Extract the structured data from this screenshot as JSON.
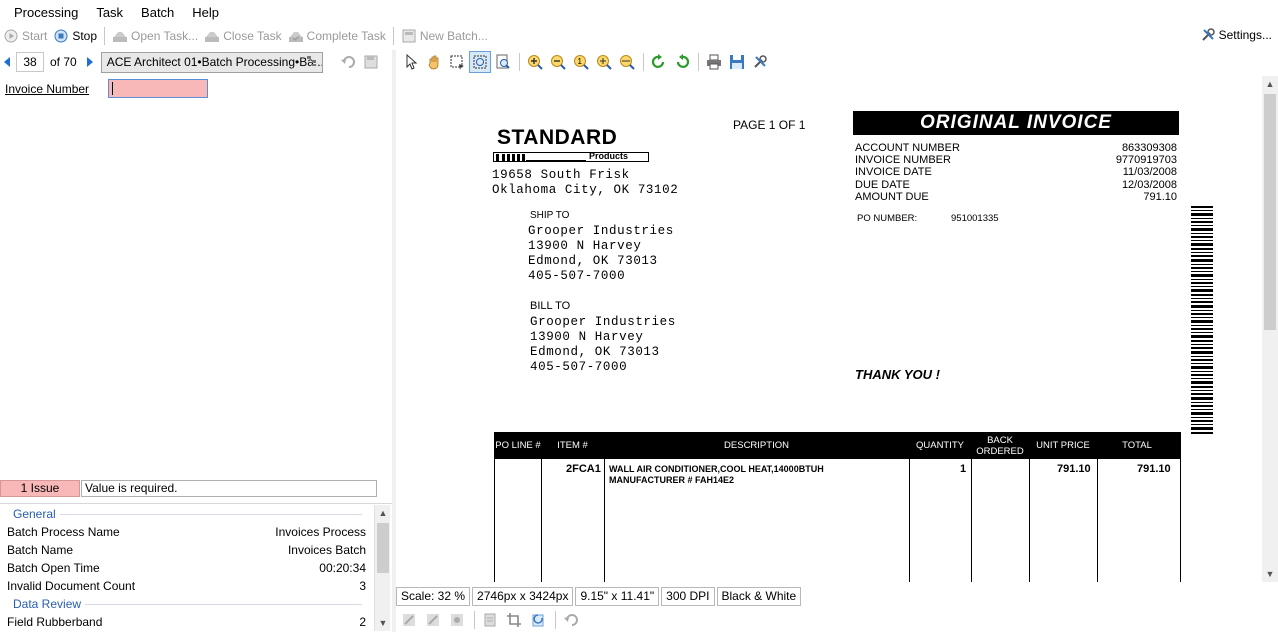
{
  "menu": [
    "Processing",
    "Task",
    "Batch",
    "Help"
  ],
  "toolbar": {
    "start": "Start",
    "stop": "Stop",
    "open_task": "Open Task...",
    "close_task": "Close Task",
    "complete_task": "Complete Task",
    "new_batch": "New Batch...",
    "settings": "Settings..."
  },
  "navigation": {
    "current_page": "38",
    "of_pages": "of 70",
    "batch_path": "ACE Architect 01•Batch Processing•Ba..."
  },
  "form": {
    "field_label": "Invoice Number",
    "field_value": ""
  },
  "issues": {
    "count_label": "1 Issue",
    "message": "Value is required."
  },
  "properties": {
    "groups": [
      {
        "name": "General",
        "rows": [
          {
            "key": "Batch Process Name",
            "value": "Invoices Process"
          },
          {
            "key": "Batch Name",
            "value": "Invoices Batch"
          },
          {
            "key": "Batch Open Time",
            "value": "00:20:34"
          },
          {
            "key": "Invalid Document Count",
            "value": "3"
          }
        ]
      },
      {
        "name": "Data Review",
        "rows": [
          {
            "key": "Field Rubberband",
            "value": "2"
          }
        ]
      }
    ]
  },
  "document": {
    "company": "STANDARD",
    "company_sub": "Products",
    "company_address": [
      "19658 South Frisk",
      "Oklahoma City, OK 73102"
    ],
    "page_of": "PAGE 1 OF 1",
    "banner": "ORIGINAL INVOICE",
    "info": [
      {
        "label": "ACCOUNT NUMBER",
        "value": "863309308"
      },
      {
        "label": "INVOICE NUMBER",
        "value": "9770919703"
      },
      {
        "label": "INVOICE DATE",
        "value": "11/03/2008"
      },
      {
        "label": "DUE DATE",
        "value": "12/03/2008"
      },
      {
        "label": "AMOUNT DUE",
        "value": "791.10"
      }
    ],
    "po_label": "PO NUMBER:",
    "po_value": "951001335",
    "ship_to_label": "SHIP TO",
    "ship_to": [
      "Grooper Industries",
      "13900 N Harvey",
      "Edmond, OK 73013",
      "405-507-7000"
    ],
    "bill_to_label": "BILL TO",
    "bill_to": [
      "Grooper Industries",
      "13900 N Harvey",
      "Edmond, OK 73013",
      "405-507-7000"
    ],
    "thanks": "THANK YOU !",
    "table_headers": [
      "PO LINE #",
      "ITEM #",
      "DESCRIPTION",
      "QUANTITY",
      "BACK ORDERED",
      "UNIT PRICE",
      "TOTAL"
    ],
    "line_item": {
      "item": "2FCA1",
      "description_1": "WALL AIR CONDITIONER,COOL HEAT,14000BTUH",
      "description_2": "MANUFACTURER # FAH14E2",
      "quantity": "1",
      "unit_price": "791.10",
      "total": "791.10"
    }
  },
  "status": {
    "scale": "Scale: 32 %",
    "pixels": "2746px x 3424px",
    "inches": "9.15\" x 11.41\"",
    "dpi": "300 DPI",
    "color_mode": "Black & White"
  }
}
